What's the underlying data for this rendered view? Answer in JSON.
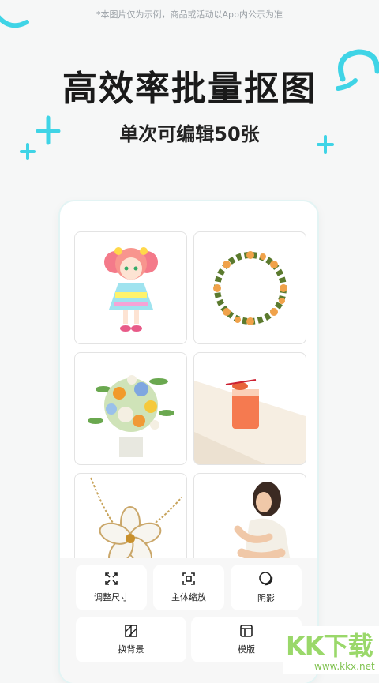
{
  "disclaimer": "*本图片仅为示例，商品或活动以App内公示为准",
  "headline": "高效率批量抠图",
  "subheadline": "单次可编辑50张",
  "colors": {
    "accent": "#3fd4e6",
    "background": "#f6f7f7",
    "title": "#1a1a1a"
  },
  "images": [
    {
      "name": "anime-girl-image",
      "icon": "anime-girl"
    },
    {
      "name": "flower-wreath-image",
      "icon": "wreath"
    },
    {
      "name": "flower-bouquet-image",
      "icon": "bouquet"
    },
    {
      "name": "drink-glass-image",
      "icon": "drink"
    },
    {
      "name": "necklace-image",
      "icon": "necklace"
    },
    {
      "name": "sitting-woman-image",
      "icon": "person"
    }
  ],
  "tools": {
    "resize": {
      "label": "调整尺寸",
      "icon": "resize-icon"
    },
    "subject_zoom": {
      "label": "主体缩放",
      "icon": "scale-icon"
    },
    "shadow": {
      "label": "阴影",
      "icon": "shadow-icon"
    },
    "background": {
      "label": "换背景",
      "icon": "background-icon"
    },
    "template": {
      "label": "模版",
      "icon": "template-icon"
    }
  },
  "watermark": {
    "text": "KK下载",
    "url": "www.kkx.net"
  }
}
